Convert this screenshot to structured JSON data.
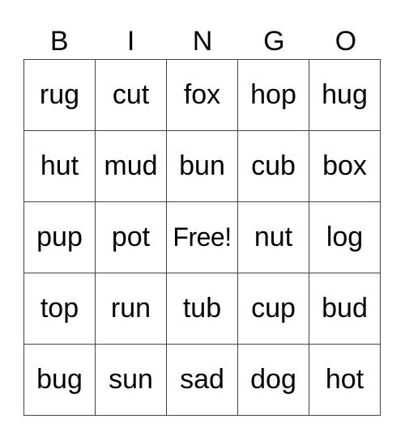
{
  "header": {
    "letters": [
      "B",
      "I",
      "N",
      "G",
      "O"
    ]
  },
  "grid": {
    "rows": [
      [
        "rug",
        "cut",
        "fox",
        "hop",
        "hug"
      ],
      [
        "hut",
        "mud",
        "bun",
        "cub",
        "box"
      ],
      [
        "pup",
        "pot",
        "Free!",
        "nut",
        "log"
      ],
      [
        "top",
        "run",
        "tub",
        "cup",
        "bud"
      ],
      [
        "bug",
        "sun",
        "sad",
        "dog",
        "hot"
      ]
    ]
  },
  "colors": {
    "grid_line": "#444444",
    "text": "#000000",
    "background": "#ffffff"
  }
}
